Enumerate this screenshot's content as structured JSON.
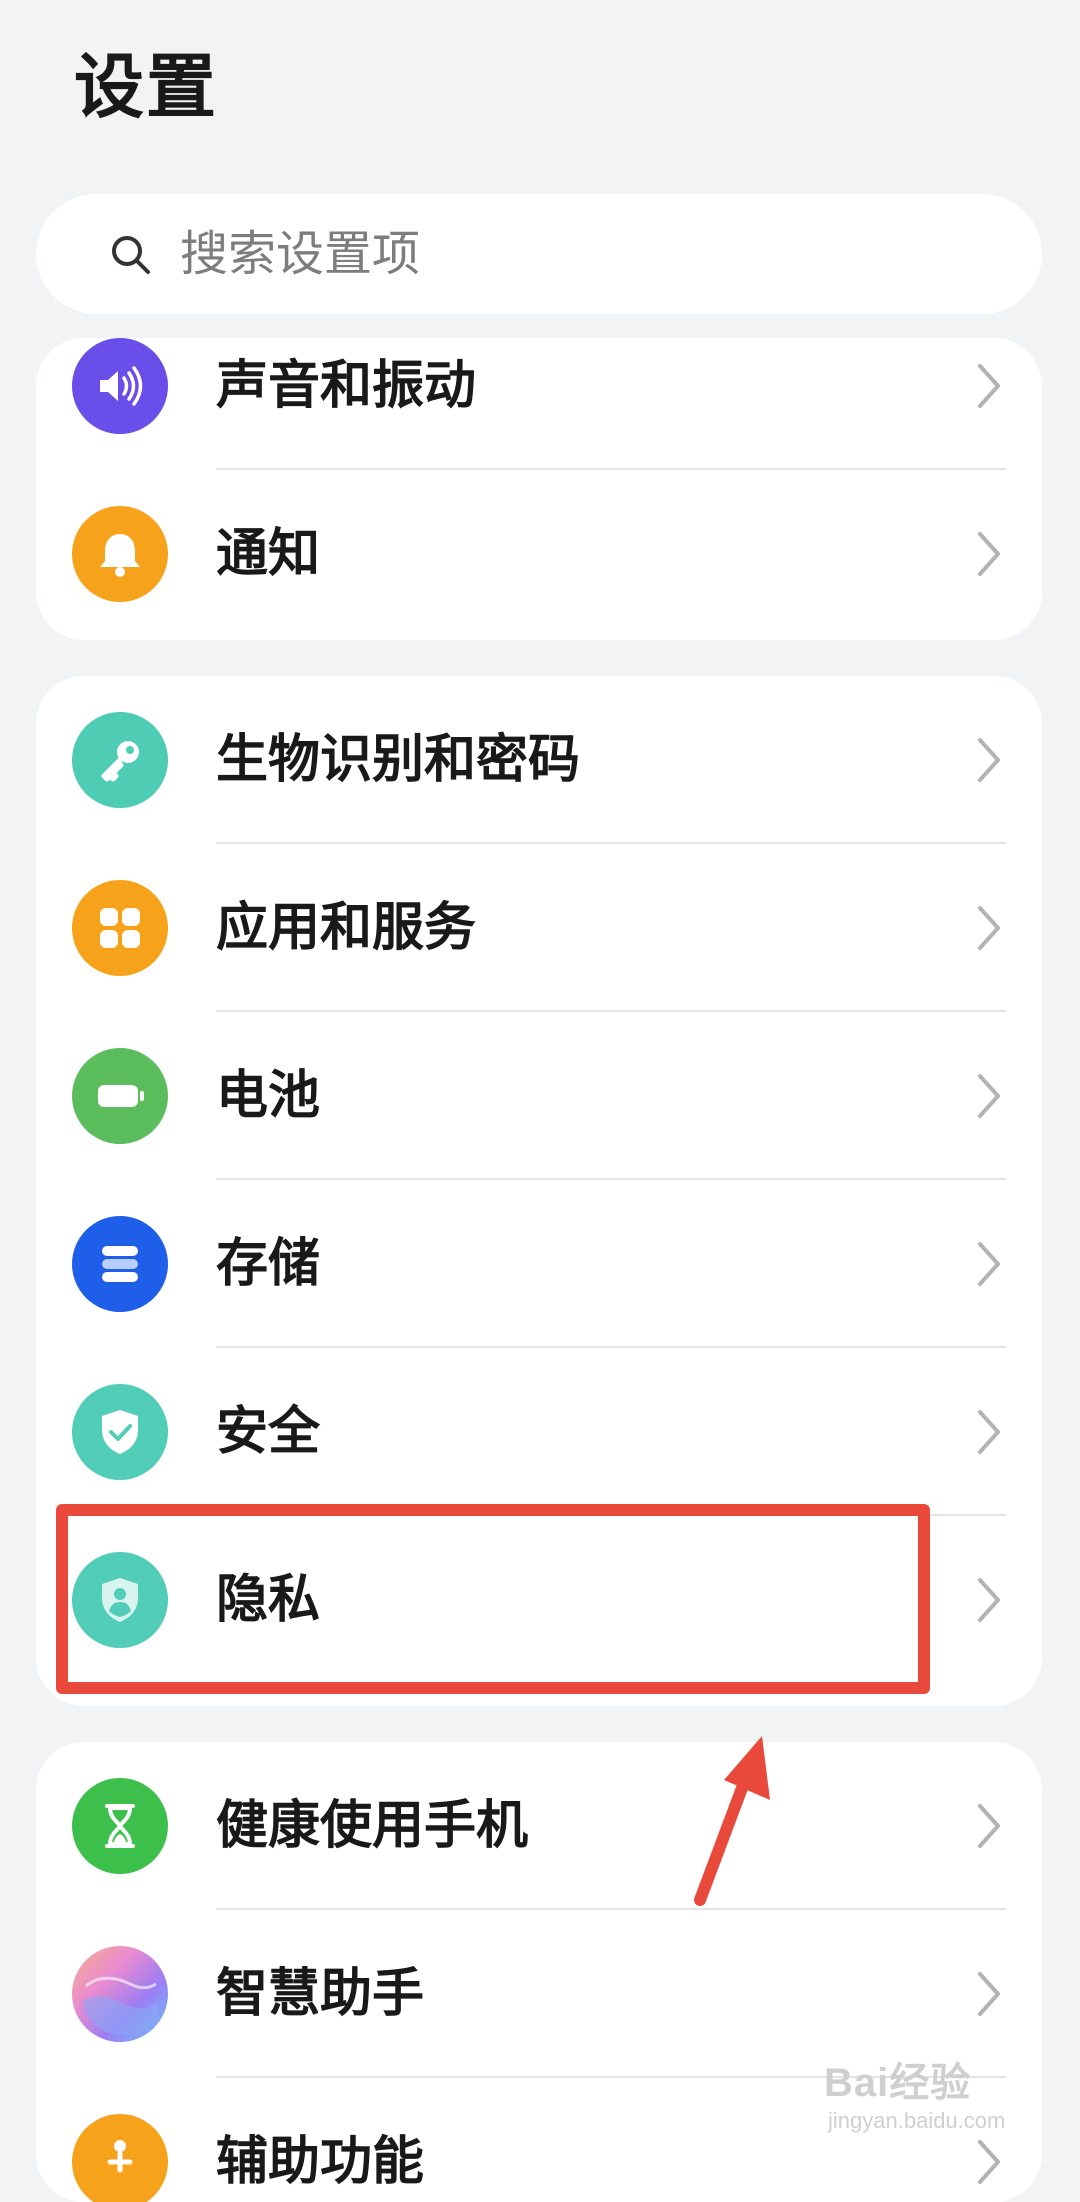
{
  "header": {
    "title": "设置"
  },
  "search": {
    "placeholder": "搜索设置项"
  },
  "groups": [
    {
      "items": [
        {
          "label": "声音和振动",
          "icon": "speaker-icon",
          "color": "#6a4ee9"
        },
        {
          "label": "通知",
          "icon": "bell-icon",
          "color": "#f7a21b"
        }
      ]
    },
    {
      "items": [
        {
          "label": "生物识别和密码",
          "icon": "key-icon",
          "color": "#4ecdb4"
        },
        {
          "label": "应用和服务",
          "icon": "apps-grid-icon",
          "color": "#f7a21b"
        },
        {
          "label": "电池",
          "icon": "battery-icon",
          "color": "#5cbd5c"
        },
        {
          "label": "存储",
          "icon": "storage-icon",
          "color": "#1f5ee8"
        },
        {
          "label": "安全",
          "icon": "shield-check-icon",
          "color": "#52cdb7"
        },
        {
          "label": "隐私",
          "icon": "shield-person-icon",
          "color": "#52cdb7"
        }
      ]
    },
    {
      "items": [
        {
          "label": "健康使用手机",
          "icon": "hourglass-icon",
          "color": "#3cc04b"
        },
        {
          "label": "智慧助手",
          "icon": "assistant-orb-icon",
          "color": "#c98bf0"
        },
        {
          "label": "辅助功能",
          "icon": "accessibility-icon",
          "color": "#f7a21b"
        }
      ]
    }
  ],
  "annotation": {
    "highlight_color": "#e8493a",
    "highlighted_item": "隐私"
  },
  "watermark": {
    "brand": "Bai经验",
    "site": "jingyan.baidu.com"
  }
}
